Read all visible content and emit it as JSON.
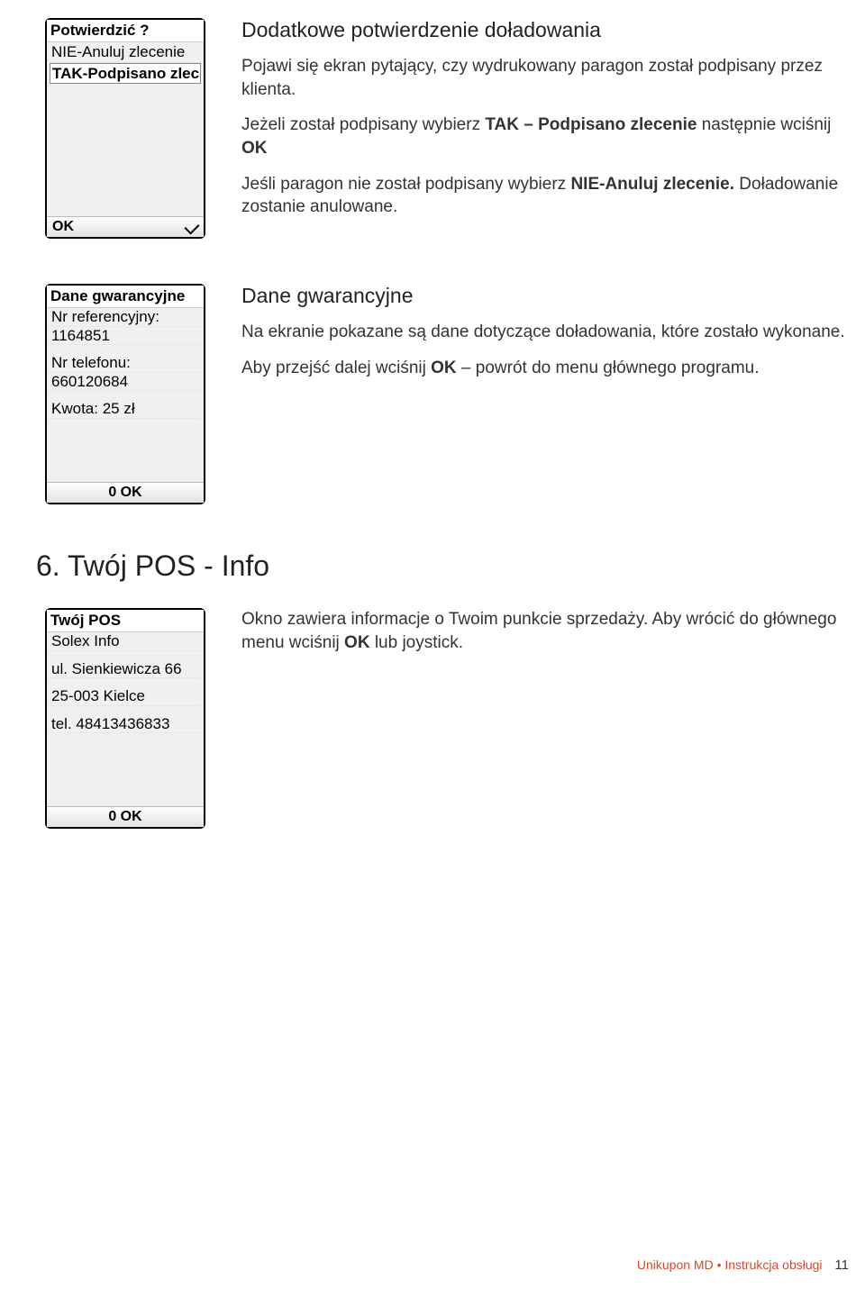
{
  "screen1": {
    "title": "Potwierdzić ?",
    "item1": "NIE-Anuluj zlecenie",
    "item2": "TAK-Podpisano zlece",
    "footer_left": "OK"
  },
  "desc1": {
    "heading": "Dodatkowe potwierdzenie doładowania",
    "p1": "Pojawi się ekran pytający, czy wydrukowany paragon został podpisany przez klienta.",
    "p2a": "Jeżeli został podpisany wybierz ",
    "p2b": "TAK – Podpisano zlecenie",
    "p2c": " następnie wciśnij ",
    "p2d": "OK",
    "p3a": "Jeśli paragon nie został podpisany wybierz ",
    "p3b": "NIE-Anuluj zlecenie.",
    "p3c": " Doładowanie zostanie anulowane."
  },
  "screen2": {
    "title": "Dane gwarancyjne",
    "l1": "Nr referencyjny:",
    "l2": "1164851",
    "l3": "Nr telefonu:",
    "l4": "660120684",
    "l5": "Kwota: 25 zł",
    "footer_center": "0   OK"
  },
  "desc2": {
    "heading": "Dane gwarancyjne",
    "p1": "Na ekranie pokazane są dane dotyczące doładowania, które zostało wykonane.",
    "p2a": "Aby przejść dalej wciśnij ",
    "p2b": "OK",
    "p2c": " – powrót do menu głównego programu."
  },
  "section6": {
    "title": "6. Twój POS - Info"
  },
  "screen3": {
    "title": "Twój POS",
    "l1": "Solex Info",
    "l2": "ul. Sienkiewicza 66",
    "l3": "25-003 Kielce",
    "l4": "tel. 48413436833",
    "footer_center": "0   OK"
  },
  "desc3": {
    "p1a": "Okno zawiera informacje o Twoim punkcie sprzedaży. Aby wrócić do głównego menu wciśnij ",
    "p1b": "OK",
    "p1c": " lub joystick."
  },
  "footer": {
    "text": "Unikupon MD • Instrukcja obsługi",
    "page": "11"
  }
}
